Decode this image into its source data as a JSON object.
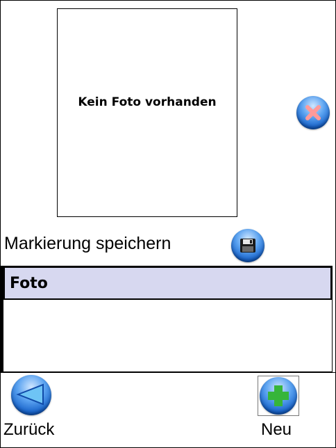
{
  "photo": {
    "placeholder_text": "Kein Foto vorhanden"
  },
  "save_marking": {
    "label": "Markierung speichern"
  },
  "list": {
    "header": "Foto",
    "items": []
  },
  "footer": {
    "back_label": "Zurück",
    "new_label": "Neu"
  },
  "colors": {
    "list_header_bg": "#d7d8f0",
    "button_blue": "#1560c8",
    "delete_red": "#ff8a8a",
    "add_green": "#36b53a"
  },
  "icons": {
    "delete": "close-icon",
    "save": "floppy-disk-icon",
    "back": "back-arrow-icon",
    "new": "plus-icon"
  }
}
